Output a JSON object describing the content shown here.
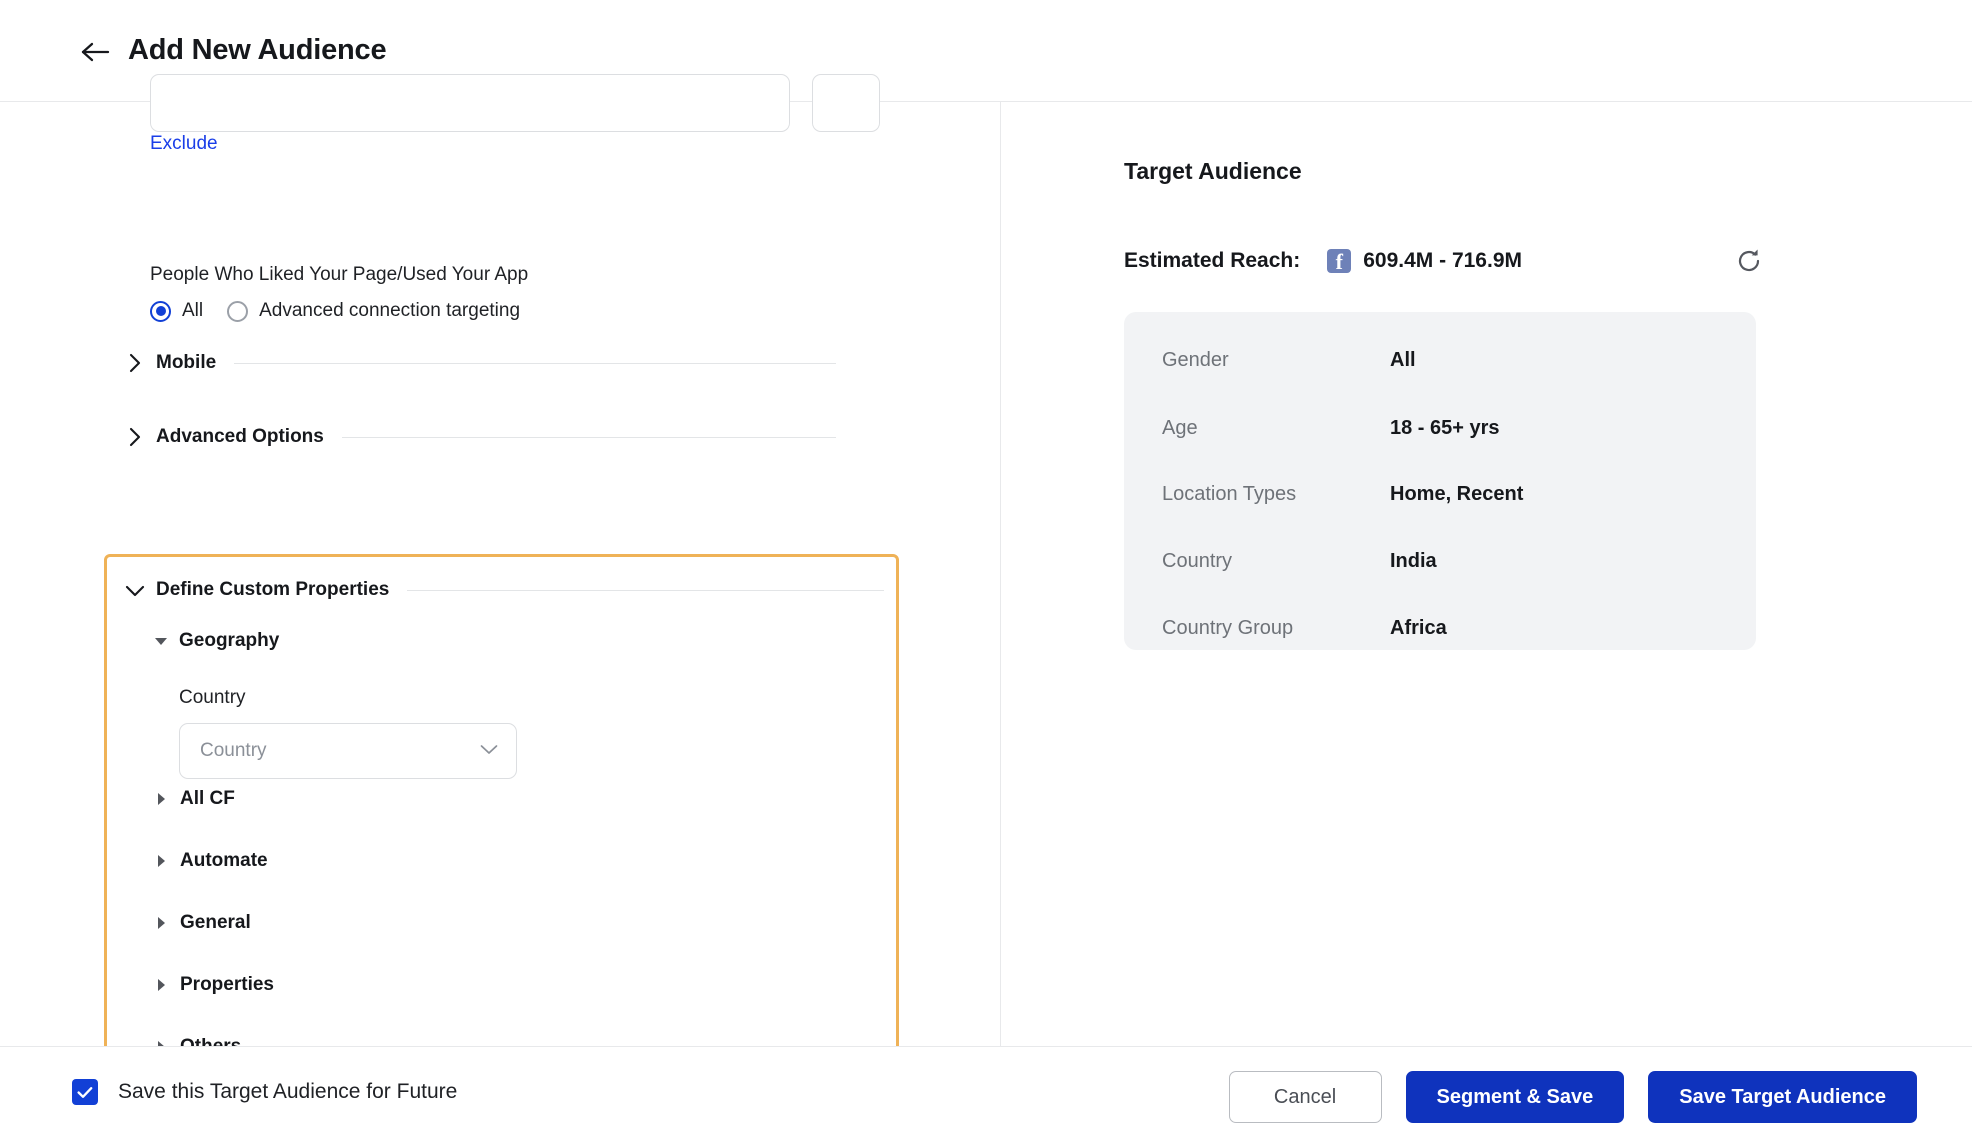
{
  "header": {
    "back_icon": "arrow-left-icon",
    "title": "Add New Audience"
  },
  "left_panel": {
    "exclude_link": "Exclude",
    "connection": {
      "label": "People Who Liked Your Page/Used Your App",
      "options": [
        {
          "label": "All",
          "selected": true
        },
        {
          "label": "Advanced connection targeting",
          "selected": false
        }
      ]
    },
    "sections": [
      {
        "label": "Mobile",
        "icon": "chevron-right-icon",
        "expanded": false
      },
      {
        "label": "Advanced Options",
        "icon": "chevron-right-icon",
        "expanded": false
      }
    ],
    "custom_properties": {
      "label": "Define Custom Properties",
      "icon": "chevron-down-icon",
      "expanded": true,
      "highlighted": true,
      "highlight_color": "#efb257",
      "geography": {
        "label": "Geography",
        "icon": "triangle-down-icon",
        "expanded": true,
        "country_field_label": "Country",
        "country_placeholder": "Country",
        "country_value": "",
        "dropdown_icon": "chevron-down-icon"
      },
      "tree_items": [
        {
          "label": "All CF",
          "icon": "triangle-right-icon"
        },
        {
          "label": "Automate",
          "icon": "triangle-right-icon"
        },
        {
          "label": "General",
          "icon": "triangle-right-icon"
        },
        {
          "label": "Properties",
          "icon": "triangle-right-icon"
        },
        {
          "label": "Others",
          "icon": "triangle-right-icon"
        }
      ]
    }
  },
  "right_panel": {
    "title": "Target Audience",
    "reach_label": "Estimated Reach:",
    "reach_platform_icon": "facebook-icon",
    "reach_value": "609.4M - 716.9M",
    "refresh_icon": "refresh-icon",
    "summary": [
      {
        "key": "Gender",
        "value": "All"
      },
      {
        "key": "Age",
        "value": "18 - 65+ yrs"
      },
      {
        "key": "Location Types",
        "value": "Home, Recent"
      },
      {
        "key": "Country",
        "value": "India"
      },
      {
        "key": "Country Group",
        "value": "Africa"
      }
    ]
  },
  "footer": {
    "save_future_label": "Save this Target Audience for Future",
    "save_future_checked": true,
    "checkbox_icon": "check-icon",
    "cancel_label": "Cancel",
    "segment_save_label": "Segment & Save",
    "save_target_label": "Save Target Audience"
  },
  "colors": {
    "accent_blue": "#0f33bd",
    "link_blue": "#1a3ee8",
    "radio_blue": "#1240d6",
    "highlight_orange": "#efb257",
    "card_bg": "#f2f3f5",
    "facebook": "#6e81b8"
  }
}
